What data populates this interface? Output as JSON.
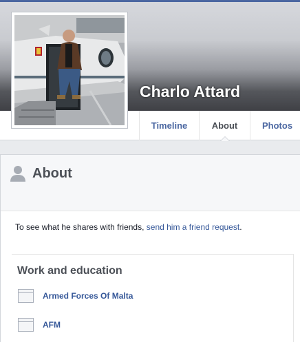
{
  "profile": {
    "name": "Charlo Attard",
    "photo_icon": "profile-photo"
  },
  "nav": {
    "tabs": [
      {
        "label": "Timeline",
        "active": false
      },
      {
        "label": "About",
        "active": true
      },
      {
        "label": "Photos",
        "active": false
      }
    ]
  },
  "about": {
    "title": "About",
    "icon": "person-icon",
    "friend_prompt": "To see what he shares with friends, ",
    "friend_link": "send him a friend request",
    "friend_suffix": "."
  },
  "work": {
    "title": "Work and education",
    "items": [
      {
        "label": "Armed Forces Of Malta",
        "icon": "workplace-icon"
      },
      {
        "label": "AFM",
        "icon": "workplace-icon"
      }
    ]
  },
  "colors": {
    "link": "#365899",
    "tab_link": "#4b67a1",
    "topbar": "#4b67a1",
    "page_bg": "#e9ebee"
  }
}
